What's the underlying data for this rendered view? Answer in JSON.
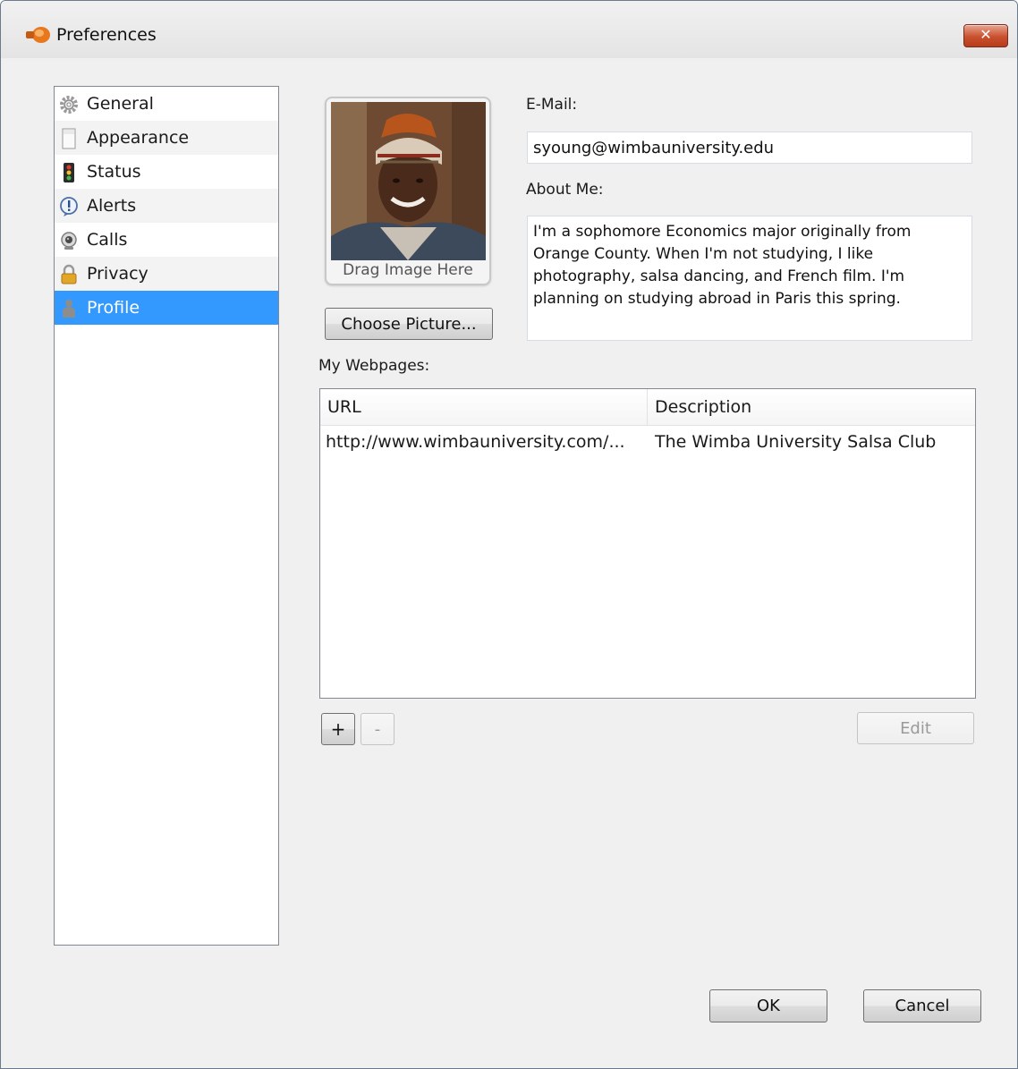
{
  "window": {
    "title": "Preferences",
    "close_glyph": "✕"
  },
  "sidebar": {
    "items": [
      {
        "label": "General",
        "icon": "gear-icon"
      },
      {
        "label": "Appearance",
        "icon": "page-icon"
      },
      {
        "label": "Status",
        "icon": "traffic-light-icon"
      },
      {
        "label": "Alerts",
        "icon": "alert-icon"
      },
      {
        "label": "Calls",
        "icon": "webcam-icon"
      },
      {
        "label": "Privacy",
        "icon": "lock-icon"
      },
      {
        "label": "Profile",
        "icon": "person-icon",
        "selected": true
      }
    ]
  },
  "profile": {
    "photo_caption": "Drag Image Here",
    "choose_picture_label": "Choose Picture...",
    "email_label": "E-Mail:",
    "email_value": "syoung@wimbauniversity.edu",
    "about_label": "About Me:",
    "about_value": "I'm a sophomore Economics major originally from Orange County. When I'm not studying, I like photography, salsa dancing, and French film. I'm planning on studying abroad in Paris this spring.",
    "webpages_label": "My Webpages:"
  },
  "webpages": {
    "columns": [
      "URL",
      "Description"
    ],
    "rows": [
      {
        "url": "http://www.wimbauniversity.com/...",
        "description": "The Wimba University Salsa Club"
      }
    ],
    "add_label": "+",
    "remove_label": "-",
    "edit_label": "Edit"
  },
  "footer": {
    "ok_label": "OK",
    "cancel_label": "Cancel"
  },
  "colors": {
    "selection": "#3399ff",
    "close_button": "#c9502e"
  }
}
